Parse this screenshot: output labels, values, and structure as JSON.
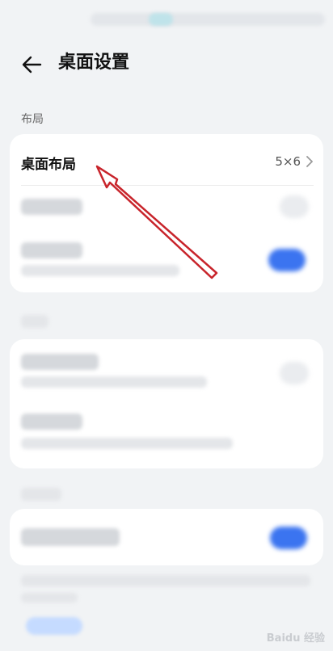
{
  "header": {
    "title": "桌面设置"
  },
  "section_layout": {
    "label": "布局"
  },
  "desktop_layout_row": {
    "label": "桌面布局",
    "value": "5×6"
  },
  "colors": {
    "accent": "#3b74f0",
    "annotation_arrow": "#c8242b"
  },
  "icons": {
    "back": "arrow-left-icon",
    "chevron": "chevron-right-icon"
  },
  "watermark": {
    "text": "Baidu 经验"
  }
}
